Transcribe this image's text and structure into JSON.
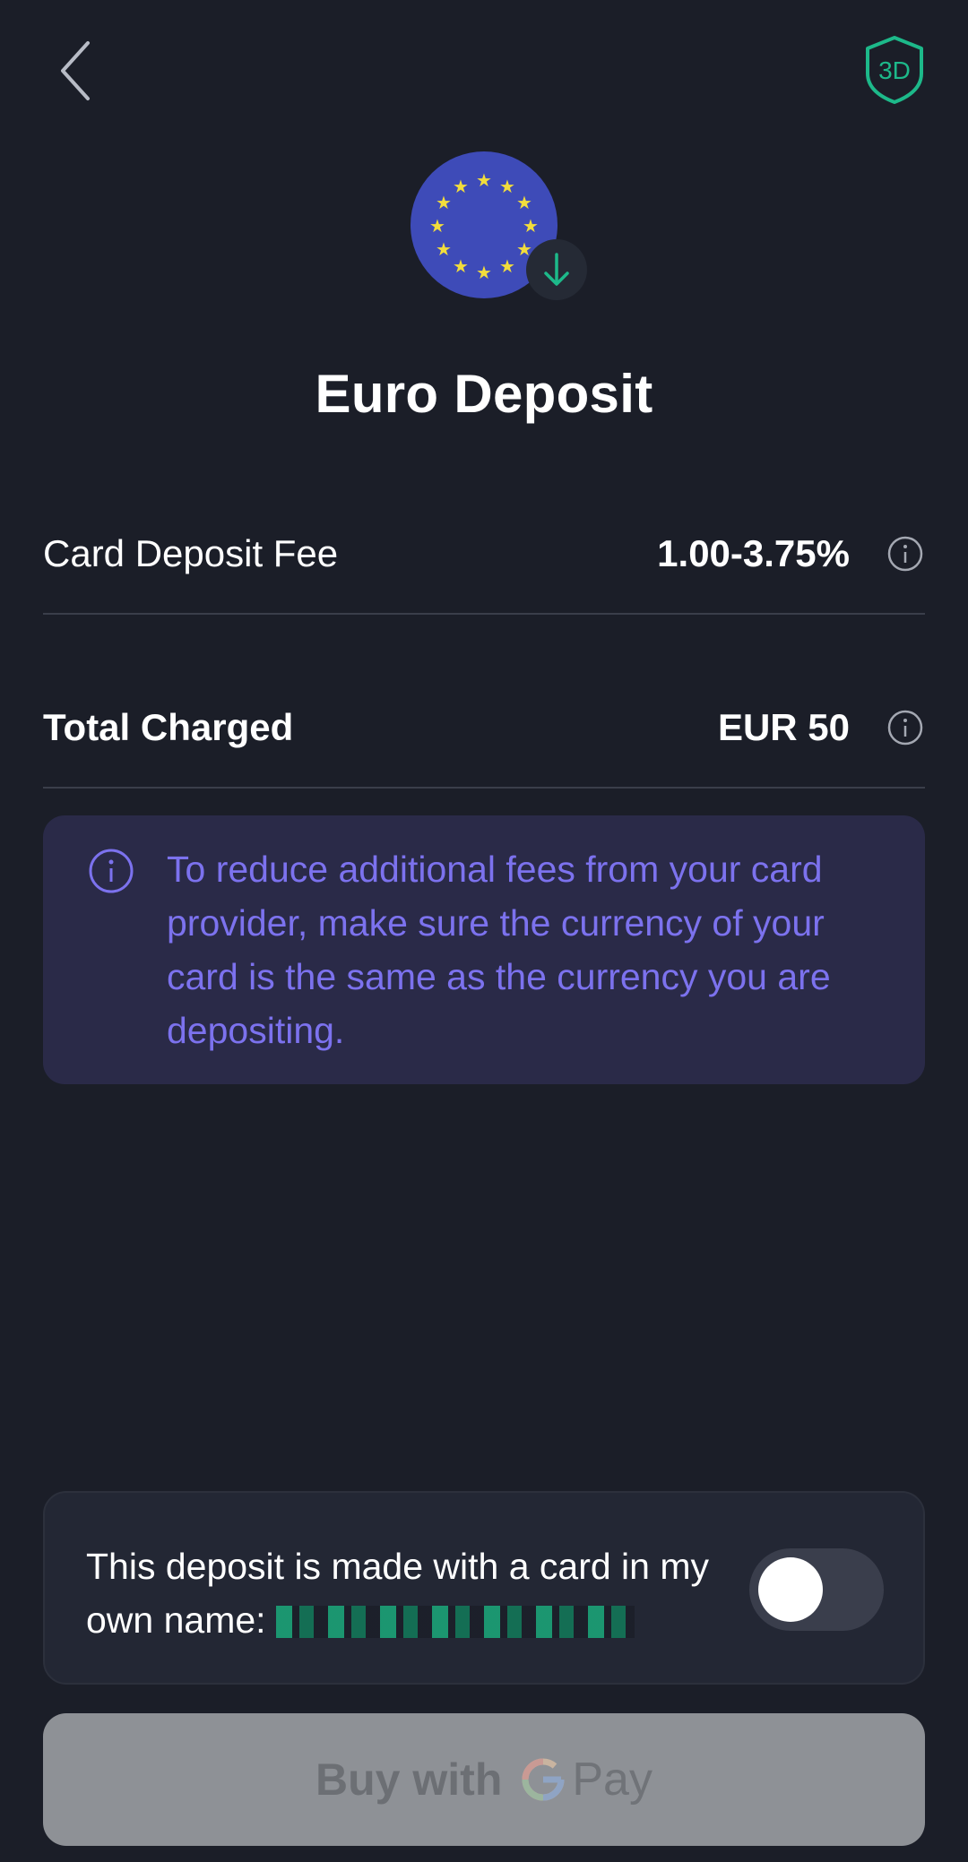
{
  "header": {
    "back_icon": "chevron-left-icon",
    "security_badge_text": "3D",
    "security_icon": "shield-3d-icon"
  },
  "currency": {
    "flag_icon": "eu-flag-icon",
    "badge_icon": "arrow-down-icon"
  },
  "title": "Euro Deposit",
  "rows": [
    {
      "label": "Card Deposit Fee",
      "value": "1.00-3.75%",
      "icon": "info-icon"
    },
    {
      "label": "Total Charged",
      "value": "EUR 50",
      "icon": "info-icon"
    }
  ],
  "notice": {
    "icon": "info-icon",
    "text": "To reduce additional fees from your card provider, make sure the currency of your card is the same as the currency you are depositing."
  },
  "consent": {
    "text": "This deposit is made with a card in my own name:",
    "toggle_on": false
  },
  "pay_button": {
    "label": "Buy with",
    "brand_g": "G",
    "brand_pay": "Pay"
  },
  "colors": {
    "background": "#1b1e28",
    "accent_green": "#1db98a",
    "notice_text": "#7c72ee",
    "notice_bg": "#2a2a48",
    "button_disabled": "#8e9196"
  }
}
